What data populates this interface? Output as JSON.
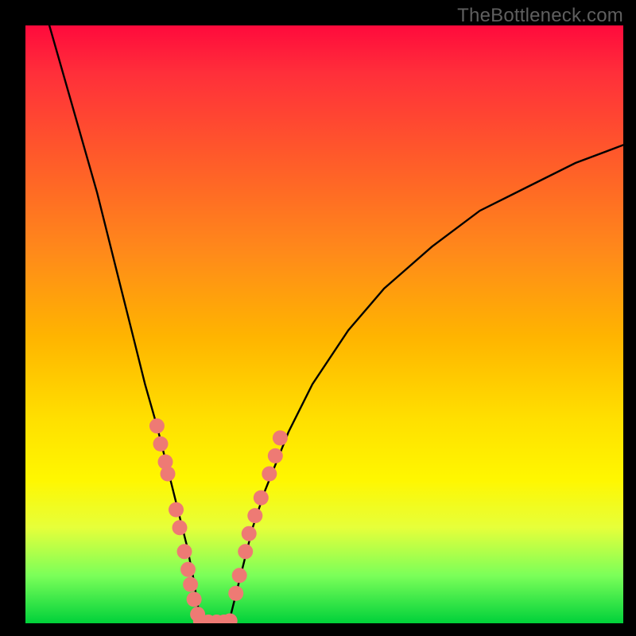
{
  "watermark_text": "TheBottleneck.com",
  "colors": {
    "frame": "#000000",
    "gradient_stops": [
      "#ff0a3c",
      "#ff2f3a",
      "#ff5a2a",
      "#ff8a1a",
      "#ffb400",
      "#ffe000",
      "#fff700",
      "#e6ff3a",
      "#7bff59",
      "#00d13a"
    ],
    "curve": "#000000",
    "dot_fill": "#ee7a74",
    "watermark": "#5f5f5f"
  },
  "chart_data": {
    "type": "line",
    "title": "",
    "xlabel": "",
    "ylabel": "",
    "xlim": [
      0,
      100
    ],
    "ylim": [
      0,
      100
    ],
    "grid": false,
    "legend": false,
    "annotations": [
      "TheBottleneck.com"
    ],
    "series": [
      {
        "name": "left-branch",
        "x": [
          4,
          8,
          12,
          16,
          18,
          20,
          22,
          24,
          25,
          26,
          27,
          28,
          28.5,
          29,
          29.5
        ],
        "y": [
          100,
          86,
          72,
          56,
          48,
          40,
          33,
          25,
          21,
          17,
          13,
          8,
          5,
          2,
          0
        ]
      },
      {
        "name": "valley-bottom",
        "x": [
          29.5,
          31,
          32.5,
          34
        ],
        "y": [
          0,
          0,
          0,
          0
        ]
      },
      {
        "name": "right-branch",
        "x": [
          34,
          36,
          38,
          40,
          44,
          48,
          54,
          60,
          68,
          76,
          84,
          92,
          100
        ],
        "y": [
          0,
          8,
          16,
          22,
          32,
          40,
          49,
          56,
          63,
          69,
          73,
          77,
          80
        ]
      }
    ],
    "points": [
      {
        "name": "left-dots",
        "x": [
          22.0,
          22.6,
          23.4,
          23.8,
          25.2,
          25.8,
          26.6,
          27.2,
          27.6,
          28.2,
          28.8
        ],
        "y": [
          33,
          30,
          27,
          25,
          19,
          16,
          12,
          9,
          6.5,
          4,
          1.5
        ]
      },
      {
        "name": "bottom-dots",
        "x": [
          29.3,
          30.6,
          32.0,
          33.2,
          34.2
        ],
        "y": [
          0.4,
          0.2,
          0.2,
          0.2,
          0.4
        ]
      },
      {
        "name": "right-dots",
        "x": [
          35.2,
          35.8,
          36.8,
          37.4,
          38.4,
          39.4,
          40.8,
          41.8,
          42.6
        ],
        "y": [
          5,
          8,
          12,
          15,
          18,
          21,
          25,
          28,
          31
        ]
      }
    ]
  }
}
